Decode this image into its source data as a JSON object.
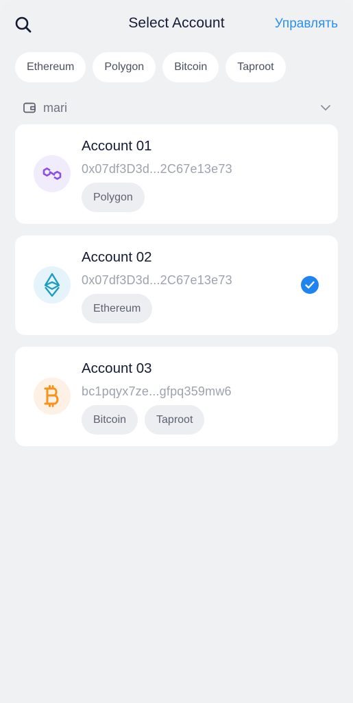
{
  "header": {
    "title": "Select Account",
    "manage_label": "Управлять",
    "search_icon": "search-icon"
  },
  "filters": [
    {
      "label": "Ethereum"
    },
    {
      "label": "Polygon"
    },
    {
      "label": "Bitcoin"
    },
    {
      "label": "Taproot"
    }
  ],
  "wallet": {
    "name": "mari",
    "icon": "wallet-icon",
    "expand_icon": "chevron-down-icon"
  },
  "accounts": [
    {
      "name": "Account 01",
      "address": "0x07df3D3d...2C67e13e73",
      "icon": "polygon-icon",
      "icon_bg": "#f1ecfc",
      "icon_color": "#8247e5",
      "tags": [
        "Polygon"
      ],
      "selected": false
    },
    {
      "name": "Account 02",
      "address": "0x07df3D3d...2C67e13e73",
      "icon": "ethereum-icon",
      "icon_bg": "#e5f3fa",
      "icon_color": "#1e9fc0",
      "tags": [
        "Ethereum"
      ],
      "selected": true
    },
    {
      "name": "Account 03",
      "address": "bc1pqyx7ze...gfpq359mw6",
      "icon": "bitcoin-icon",
      "icon_bg": "#fdf1e5",
      "icon_color": "#f7931a",
      "tags": [
        "Bitcoin",
        "Taproot"
      ],
      "selected": false
    }
  ],
  "colors": {
    "accent": "#1e84f0",
    "link": "#2c8ff0",
    "background": "#f0f1f3",
    "card": "#ffffff"
  }
}
